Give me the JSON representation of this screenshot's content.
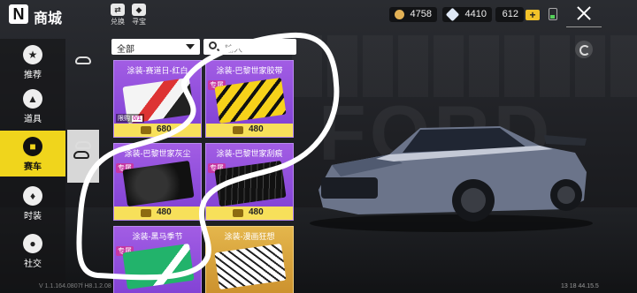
{
  "header": {
    "title": "商城",
    "buttons": [
      {
        "label": "兑换",
        "icon": "exchange-icon"
      },
      {
        "label": "寻宝",
        "icon": "treasure-icon"
      }
    ],
    "currencies": [
      {
        "icon": "coin-icon",
        "value": "4758"
      },
      {
        "icon": "diamond-icon",
        "value": "4410"
      },
      {
        "icon": "ticket-icon",
        "value": "612"
      }
    ]
  },
  "sidebar": {
    "items": [
      {
        "label": "推荐",
        "icon": "recommend-icon"
      },
      {
        "label": "道具",
        "icon": "item-icon"
      },
      {
        "label": "赛车",
        "icon": "car-icon"
      },
      {
        "label": "时装",
        "icon": "fashion-icon"
      },
      {
        "label": "社交",
        "icon": "social-icon"
      }
    ],
    "active": "赛车"
  },
  "filter": {
    "selected": "全部",
    "search_placeholder": "输入"
  },
  "cards": [
    {
      "name": "涂装-赛道日-红白",
      "exclusive": "",
      "price": "680",
      "limited": "限购",
      "limited_count": "0/1"
    },
    {
      "name": "涂装-巴黎世家胶带",
      "exclusive": "专属",
      "price": "480"
    },
    {
      "name": "涂装-巴黎世家灰尘",
      "exclusive": "专属",
      "price": "480"
    },
    {
      "name": "涂装-巴黎世家刮痕",
      "exclusive": "专属",
      "price": "480"
    },
    {
      "name": "涂装-黑马季节",
      "exclusive": "专属",
      "price": ""
    },
    {
      "name": "涂装-漫画狂想",
      "exclusive": "",
      "price": ""
    }
  ],
  "footer": {
    "left": "V 1.1.164.0807f H8.1.2.08",
    "right": "13 18 44.15.5"
  }
}
